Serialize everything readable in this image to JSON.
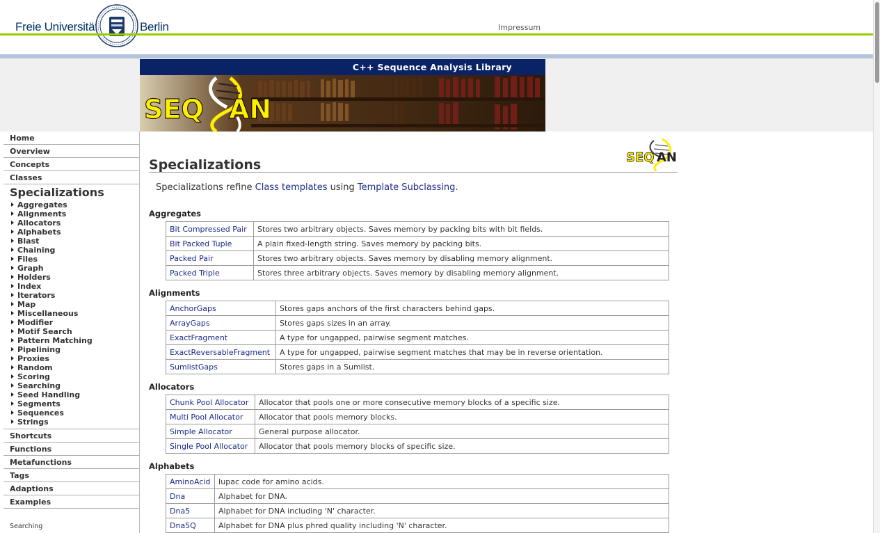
{
  "header": {
    "uni_left": "Freie Universität",
    "uni_right": "Berlin",
    "impressum": "Impressum"
  },
  "banner": {
    "title": "C++ Sequence Analysis Library",
    "logo_text": "SEQAN"
  },
  "nav": {
    "top_items": [
      "Home",
      "Overview",
      "Concepts",
      "Classes"
    ],
    "active": "Specializations",
    "sub_items": [
      "Aggregates",
      "Alignments",
      "Allocators",
      "Alphabets",
      "Blast",
      "Chaining",
      "Files",
      "Graph",
      "Holders",
      "Index",
      "Iterators",
      "Map",
      "Miscellaneous",
      "Modifier",
      "Motif Search",
      "Pattern Matching",
      "Pipelining",
      "Proxies",
      "Random",
      "Scoring",
      "Searching",
      "Seed Handling",
      "Segments",
      "Sequences",
      "Strings"
    ],
    "bottom_items": [
      "Shortcuts",
      "Functions",
      "Metafunctions",
      "Tags",
      "Adaptions",
      "Examples"
    ],
    "footer_text": "Searching"
  },
  "content": {
    "title": "Specializations",
    "intro_prefix": "Specializations refine ",
    "intro_link1": "Class templates",
    "intro_mid": " using ",
    "intro_link2": "Template Subclassing",
    "intro_suffix": ".",
    "sections": [
      {
        "heading": "Aggregates",
        "rows": [
          {
            "name": "Bit Compressed Pair",
            "desc": "Stores two arbitrary objects. Saves memory by packing bits with bit fields."
          },
          {
            "name": "Bit Packed Tuple",
            "desc": "A plain fixed-length string. Saves memory by packing bits."
          },
          {
            "name": "Packed Pair",
            "desc": "Stores two arbitrary objects. Saves memory by disabling memory alignment."
          },
          {
            "name": "Packed Triple",
            "desc": "Stores three arbitrary objects. Saves memory by disabling memory alignment."
          }
        ]
      },
      {
        "heading": "Alignments",
        "rows": [
          {
            "name": "AnchorGaps",
            "desc": "Stores gaps anchors of the first characters behind gaps."
          },
          {
            "name": "ArrayGaps",
            "desc": "Stores gaps sizes in an array."
          },
          {
            "name": "ExactFragment",
            "desc": "A type for ungapped, pairwise segment matches."
          },
          {
            "name": "ExactReversableFragment",
            "desc": "A type for ungapped, pairwise segment matches that may be in reverse orientation."
          },
          {
            "name": "SumlistGaps",
            "desc": "Stores gaps in a Sumlist."
          }
        ]
      },
      {
        "heading": "Allocators",
        "rows": [
          {
            "name": "Chunk Pool Allocator",
            "desc": "Allocator that pools one or more consecutive memory blocks of a specific size."
          },
          {
            "name": "Multi Pool Allocator",
            "desc": "Allocator that pools memory blocks."
          },
          {
            "name": "Simple Allocator",
            "desc": "General purpose allocator."
          },
          {
            "name": "Single Pool Allocator",
            "desc": "Allocator that pools memory blocks of specific size."
          }
        ]
      },
      {
        "heading": "Alphabets",
        "rows": [
          {
            "name": "AminoAcid",
            "desc": "Iupac code for amino acids."
          },
          {
            "name": "Dna",
            "desc": "Alphabet for DNA."
          },
          {
            "name": "Dna5",
            "desc": "Alphabet for DNA including 'N' character."
          },
          {
            "name": "Dna5Q",
            "desc": "Alphabet for DNA plus phred quality including 'N' character."
          }
        ]
      }
    ]
  },
  "colors": {
    "green_rule": "#99cc00",
    "blue_rule": "#b3c4dc",
    "banner_bar": "#0a2266",
    "link": "#1a2a88",
    "logo_yellow": "#ffee00"
  }
}
